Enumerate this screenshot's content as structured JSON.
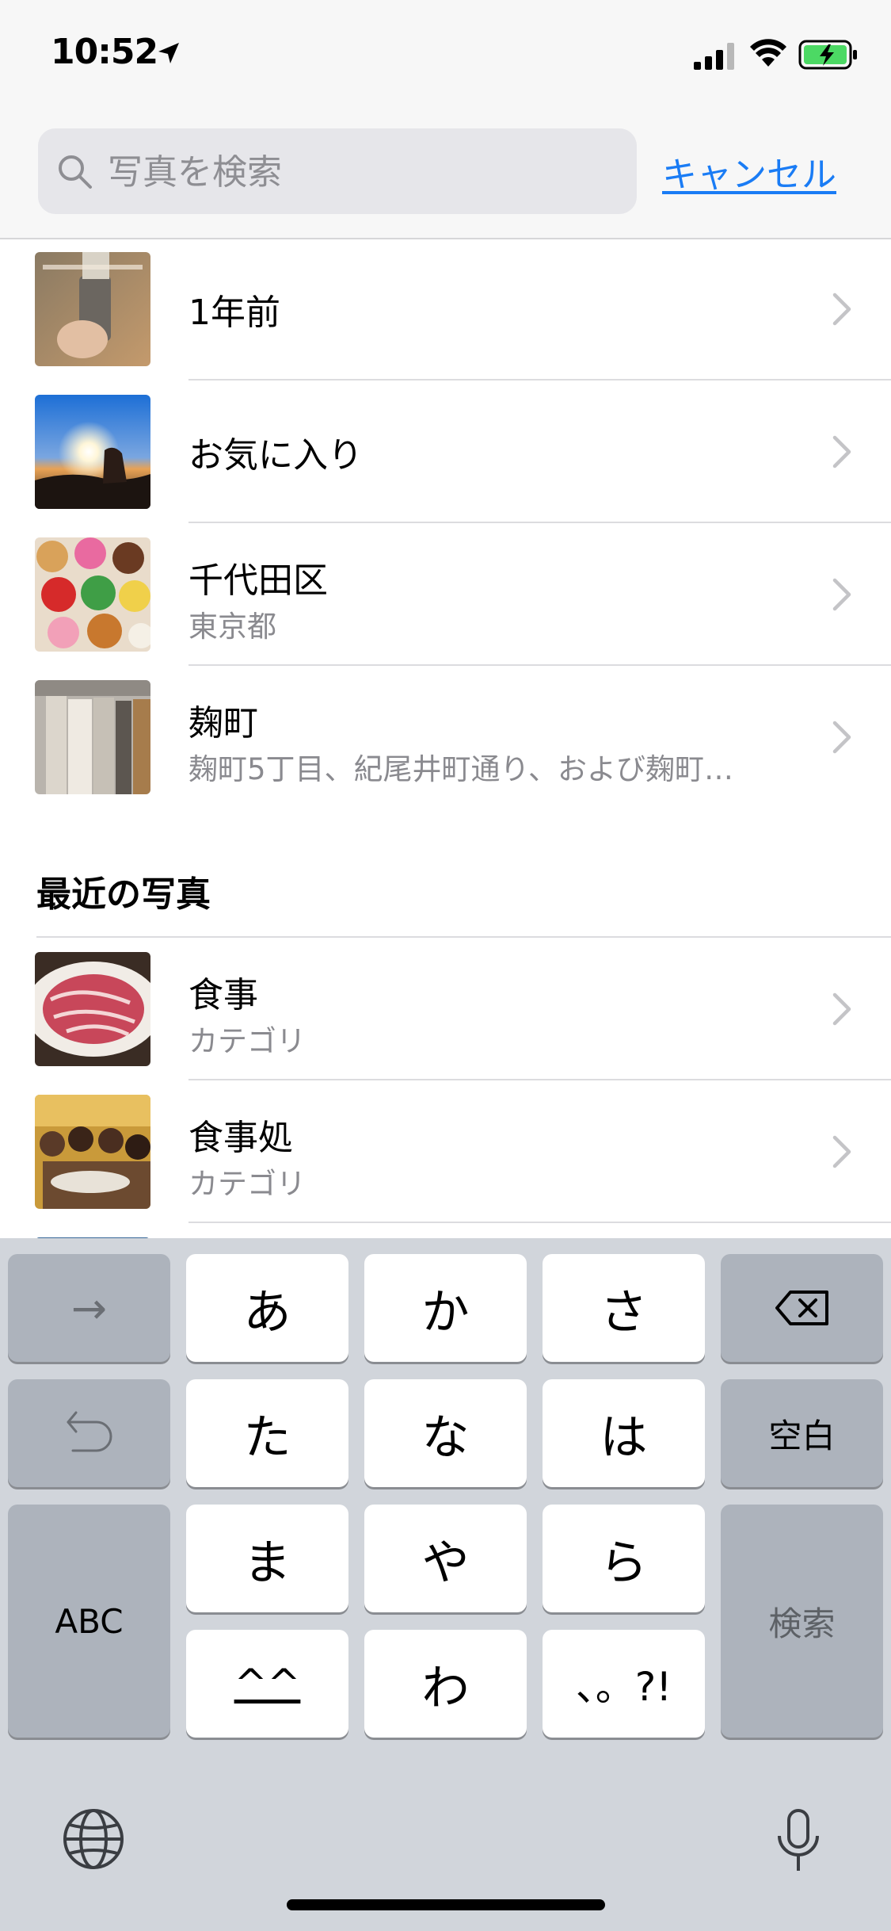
{
  "status_bar": {
    "time": "10:52",
    "colors": {
      "battery_fill": "#4cd964"
    }
  },
  "search": {
    "placeholder": "写真を検索",
    "value": "",
    "cancel_label": "キャンセル",
    "accent_color": "#1a7cf5"
  },
  "results": [
    {
      "title": "1年前",
      "subtitle": ""
    },
    {
      "title": "お気に入り",
      "subtitle": ""
    },
    {
      "title": "千代田区",
      "subtitle": "東京都"
    },
    {
      "title": "麹町",
      "subtitle": "麹町5丁目、紀尾井町通り、および麹町…"
    }
  ],
  "recent": {
    "header": "最近の写真",
    "items": [
      {
        "title": "食事",
        "subtitle": "カテゴリ"
      },
      {
        "title": "食事処",
        "subtitle": "カテゴリ"
      }
    ]
  },
  "keyboard": {
    "arrow_right": "→",
    "undo_icon": "undo-icon",
    "delete_icon": "delete-icon",
    "kana": [
      "あ",
      "か",
      "さ",
      "た",
      "な",
      "は",
      "ま",
      "や",
      "ら",
      "^^",
      "わ",
      "、。?!"
    ],
    "space_label": "空白",
    "abc_label": "ABC",
    "search_label": "検索",
    "globe_icon": "globe-icon",
    "mic_icon": "microphone-icon"
  }
}
